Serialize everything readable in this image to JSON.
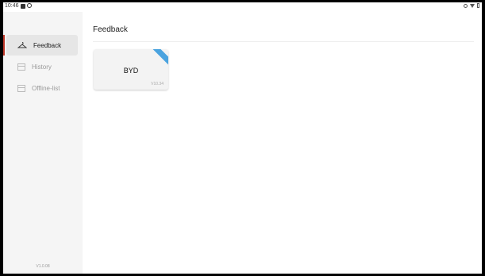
{
  "statusbar": {
    "time": "10:46",
    "icons": [
      "notification-square-icon",
      "notification-circle-icon",
      "signal-dot-icon",
      "wifi-icon",
      "battery-icon"
    ]
  },
  "sidebar": {
    "items": [
      {
        "label": "Feedback",
        "icon": "hanger-icon",
        "active": true
      },
      {
        "label": "History",
        "icon": "calendar-icon",
        "active": false
      },
      {
        "label": "Offline-list",
        "icon": "calendar-icon",
        "active": false
      }
    ],
    "version": "V1.0.08"
  },
  "main": {
    "title": "Feedback",
    "cards": [
      {
        "name": "BYD",
        "version": "V10.34",
        "ribbon_color": "#4aa3df"
      }
    ]
  },
  "colors": {
    "accent": "#c0392b",
    "sidebar_bg": "#f5f5f5"
  }
}
